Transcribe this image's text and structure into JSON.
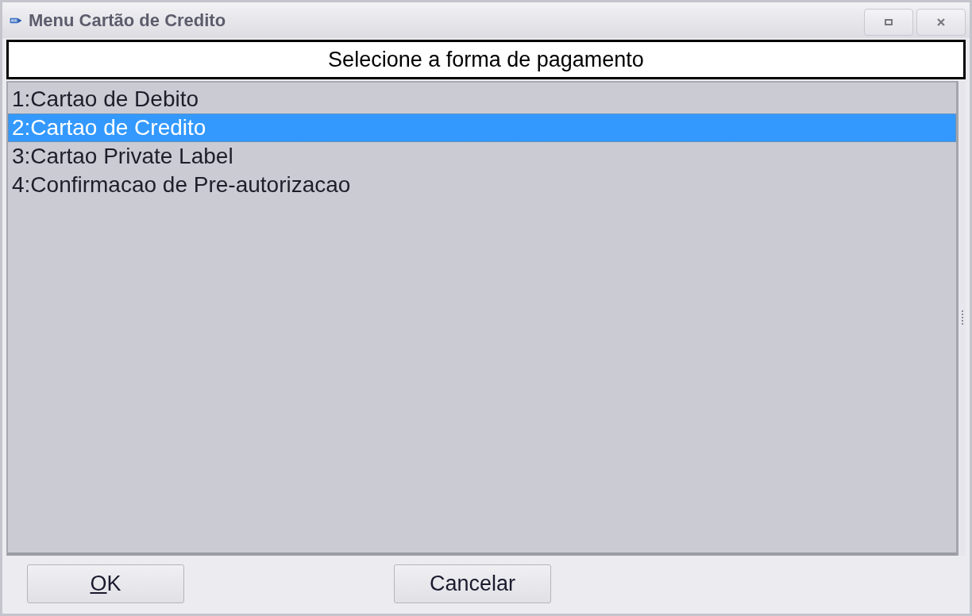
{
  "window": {
    "title": "Menu Cartão de Credito"
  },
  "prompt": "Selecione a forma de pagamento",
  "options": [
    {
      "label": "1:Cartao de Debito",
      "selected": false
    },
    {
      "label": "2:Cartao de Credito",
      "selected": true
    },
    {
      "label": "3:Cartao Private Label",
      "selected": false
    },
    {
      "label": "4:Confirmacao de Pre-autorizacao",
      "selected": false
    }
  ],
  "buttons": [
    {
      "label": "OK",
      "underline_first": true
    },
    {
      "label": "Cancelar",
      "underline_first": false
    }
  ]
}
